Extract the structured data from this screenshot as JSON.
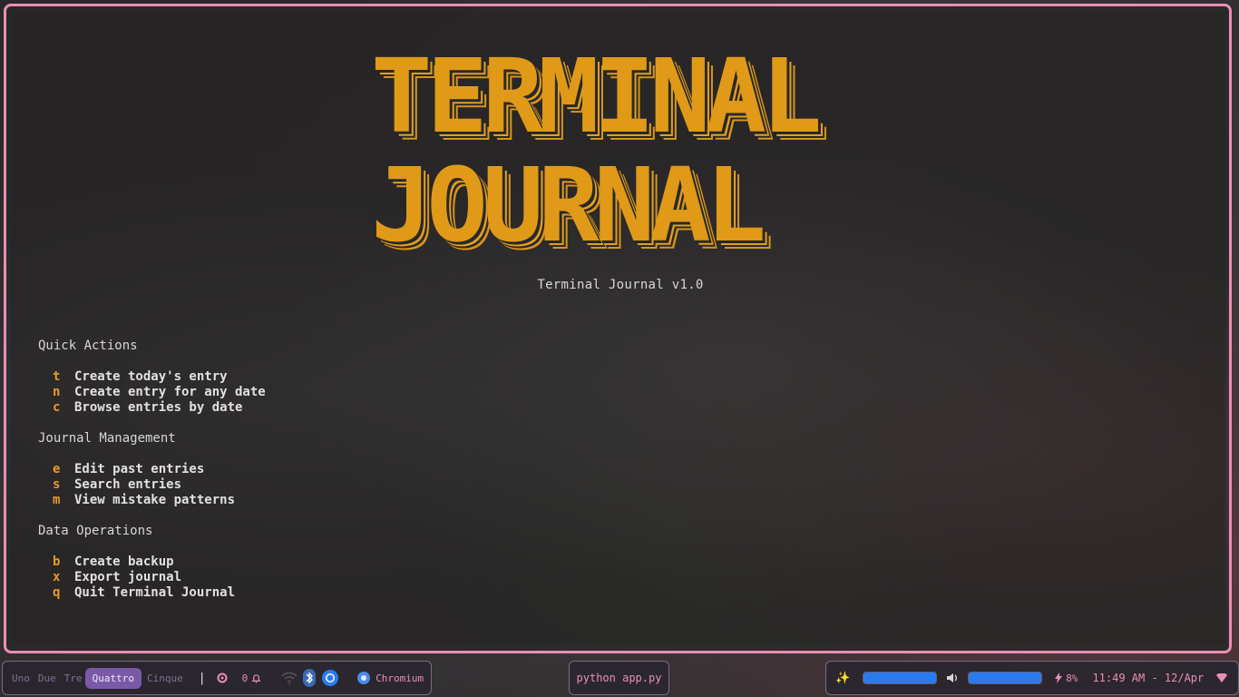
{
  "app": {
    "logo_line1": "TERMINAL",
    "logo_line2": "JOURNAL",
    "version": "Terminal Journal v1.0"
  },
  "sections": [
    {
      "title": "Quick Actions",
      "items": [
        {
          "key": "t",
          "label": "Create today's entry"
        },
        {
          "key": "n",
          "label": "Create entry for any date"
        },
        {
          "key": "c",
          "label": "Browse entries by date"
        }
      ]
    },
    {
      "title": "Journal Management",
      "items": [
        {
          "key": "e",
          "label": "Edit past entries"
        },
        {
          "key": "s",
          "label": "Search entries"
        },
        {
          "key": "m",
          "label": "View mistake patterns"
        }
      ]
    },
    {
      "title": "Data Operations",
      "items": [
        {
          "key": "b",
          "label": "Create backup"
        },
        {
          "key": "x",
          "label": "Export journal"
        },
        {
          "key": "q",
          "label": "Quit Terminal Journal"
        }
      ]
    }
  ],
  "taskbar": {
    "workspaces": [
      "Uno",
      "Due",
      "Tre",
      "Quattro",
      "Cinque"
    ],
    "active_workspace": "Quattro",
    "separator": "|",
    "notifications_count": "0",
    "window_title": "Chromium",
    "active_command": "python app.py",
    "battery": "8%",
    "clock": "11:49 AM - 12/Apr",
    "brightness_level": 1.0,
    "volume_level": 1.0
  },
  "colors": {
    "accent_orange": "#e09a18",
    "frame_pink": "#e98fb6",
    "workspace_active": "#7a5aa8",
    "slider_blue": "#2a7bf0"
  }
}
